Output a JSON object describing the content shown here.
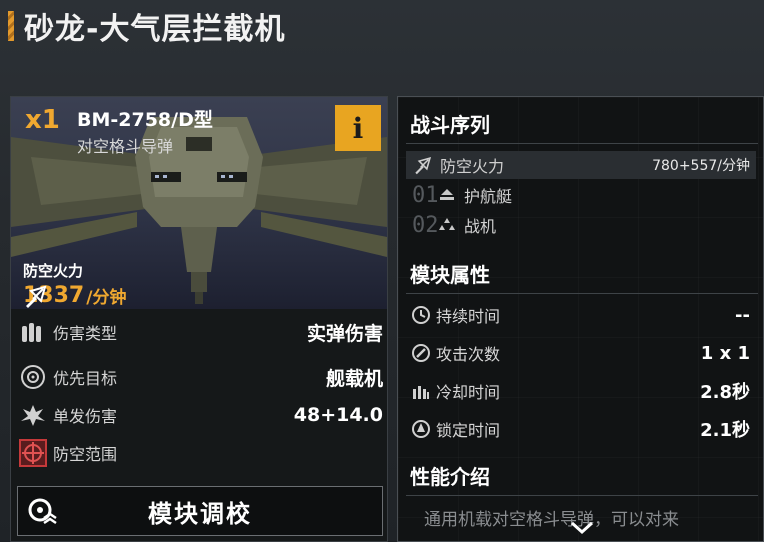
{
  "page": {
    "title": "砂龙-大气层拦截机"
  },
  "module_card": {
    "quantity": "x1",
    "model_name": "BM-2758/D型",
    "model_type": "对空格斗导弹",
    "info_button_label": "i",
    "primary_stat_label": "防空火力",
    "primary_stat_value": "1337",
    "primary_stat_unit": "/分钟",
    "stats": [
      {
        "label": "伤害类型",
        "value": "实弹伤害",
        "icon": "ammo-icon"
      },
      {
        "label": "优先目标",
        "value": "舰载机",
        "icon": "target-icon"
      },
      {
        "label": "单发伤害",
        "value": "48+14.0",
        "icon": "damage-icon"
      },
      {
        "label": "防空范围",
        "value": "",
        "icon": "range-icon"
      }
    ],
    "tune_button_label": "模块调校"
  },
  "detail_panel": {
    "sequence_title": "战斗序列",
    "sequence": [
      {
        "num": "",
        "label": "防空火力",
        "value": "780+557/分钟",
        "icon": "anti-air-icon"
      },
      {
        "num": "01",
        "label": "护航艇",
        "value": "",
        "icon": "escort-icon"
      },
      {
        "num": "02",
        "label": "战机",
        "value": "",
        "icon": "fighter-icon"
      }
    ],
    "attributes_title": "模块属性",
    "attributes": [
      {
        "label": "持续时间",
        "value": "--",
        "icon": "clock-icon"
      },
      {
        "label": "攻击次数",
        "value": "1 x 1",
        "icon": "attack-count-icon"
      },
      {
        "label": "冷却时间",
        "value": "2.8秒",
        "icon": "cooldown-icon"
      },
      {
        "label": "锁定时间",
        "value": "2.1秒",
        "icon": "lock-icon"
      }
    ],
    "performance_title": "性能介绍",
    "performance_text": "通用机载对空格斗导弹，可以对来"
  },
  "colors": {
    "accent": "#f0a830",
    "info_button": "#e8a521",
    "range_icon": "#c4393a"
  }
}
